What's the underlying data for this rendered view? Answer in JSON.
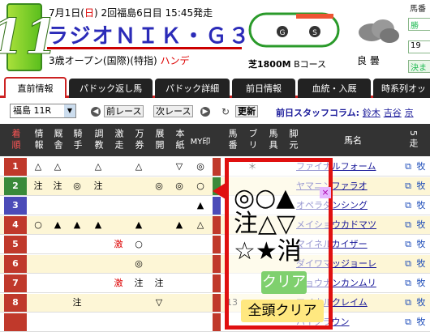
{
  "header": {
    "race_number": "11",
    "date": "7月1日(",
    "weekday": "日",
    "date_rest": ")  2回福島6日目  15:45発走",
    "race_name": "ラジオＮＩＫ・Ｇ３",
    "condition": "3歳オープン(国際)(特指)",
    "handicap": "ハンデ",
    "distance": "芝1800M",
    "course": "Bコース",
    "track_condition": "良 曇",
    "right_tab_1": "馬番",
    "right_tab_2": "勝",
    "right_tab_3": "19",
    "right_tab_4": "決ま",
    "track_marker_1": "G",
    "track_marker_2": "S"
  },
  "tabs": [
    "直前情報",
    "パドック返し馬",
    "パドック詳細",
    "前日情報",
    "血統・入厩",
    "時系列オッ"
  ],
  "toolbar": {
    "race_select": "福島 11R",
    "prev_label": "前レース",
    "next_label": "次レース",
    "refresh_label": "更新",
    "staff_prefix": "前日スタッフコラム:",
    "staff_1": "鈴木",
    "staff_2": "吉谷",
    "staff_3": "京"
  },
  "columns": [
    "着順",
    "情報",
    "厩舎",
    "騎手",
    "調教",
    "激走",
    "万券",
    "展開",
    "本紙",
    "MY印",
    "馬番",
    "ブリ",
    "馬具",
    "脚元",
    "馬名",
    "5走"
  ],
  "rows": [
    {
      "rank": "1",
      "rank_color": "#c0392b",
      "marks": [
        "△",
        "△",
        "",
        "△",
        "",
        "△",
        "",
        "▽",
        "◎"
      ],
      "my": "",
      "num": "",
      "bri": "＊",
      "name": "ファイナルフォーム",
      "link": ""
    },
    {
      "rank": "2",
      "rank_color": "#3a8a3a",
      "marks": [
        "注",
        "注",
        "◎",
        "注",
        "",
        "",
        "◎",
        "◎",
        "○"
      ],
      "my": "",
      "num": "",
      "bri": "",
      "name": "ヤマニンファラオ",
      "link": ""
    },
    {
      "rank": "3",
      "rank_color": "#4b4bb8",
      "marks": [
        "",
        "",
        "",
        "",
        "",
        "",
        "",
        "",
        "▲"
      ],
      "my": "",
      "num": "",
      "bri": "",
      "name": "オペラダンシング",
      "link": ""
    },
    {
      "rank": "4",
      "rank_color": "#c0392b",
      "marks": [
        "○",
        "▲",
        "▲",
        "▲",
        "",
        "▲",
        "",
        "▲",
        "△"
      ],
      "my": "",
      "num": "",
      "bri": "",
      "name": "メイショウカドマツ",
      "link": ""
    },
    {
      "rank": "5",
      "rank_color": "#c0392b",
      "marks": [
        "",
        "",
        "",
        "",
        "激",
        "○",
        "",
        "",
        ""
      ],
      "my": "",
      "num": "",
      "bri": "",
      "name": "マイネルカイザー",
      "link": ""
    },
    {
      "rank": "6",
      "rank_color": "#c0392b",
      "marks": [
        "",
        "",
        "",
        "",
        "",
        "◎",
        "",
        "",
        ""
      ],
      "my": "",
      "num": "",
      "bri": "",
      "name": "ダイワマッジョーレ",
      "link": ""
    },
    {
      "rank": "7",
      "rank_color": "#c0392b",
      "marks": [
        "",
        "",
        "",
        "",
        "激",
        "注",
        "注",
        "",
        ""
      ],
      "my": "",
      "num": "",
      "bri": "",
      "name": "ショウナンカンムリ",
      "link": ""
    },
    {
      "rank": "8",
      "rank_color": "#c0392b",
      "marks": [
        "",
        "",
        "注",
        "",
        "",
        "",
        "▽",
        "",
        ""
      ],
      "my": "",
      "num": "13",
      "bri": "",
      "name": "マイネルクレイム",
      "link": ""
    },
    {
      "rank": "",
      "rank_color": "#c0392b",
      "marks": [
        "",
        "",
        "",
        "",
        "",
        "",
        "",
        "",
        ""
      ],
      "my": "",
      "num": "",
      "bri": "",
      "name": "ハイクラウン",
      "link": ""
    }
  ],
  "popup": {
    "marks_row1": "◎○▲",
    "marks_row2": "注△▽",
    "marks_row3": "☆★消",
    "clear_label": "クリア",
    "all_clear_label": "全頭クリア",
    "x_badge": "×"
  },
  "colors": {
    "accent": "#e01010",
    "tab_active_border": "#c22",
    "header_bg": "#333"
  }
}
